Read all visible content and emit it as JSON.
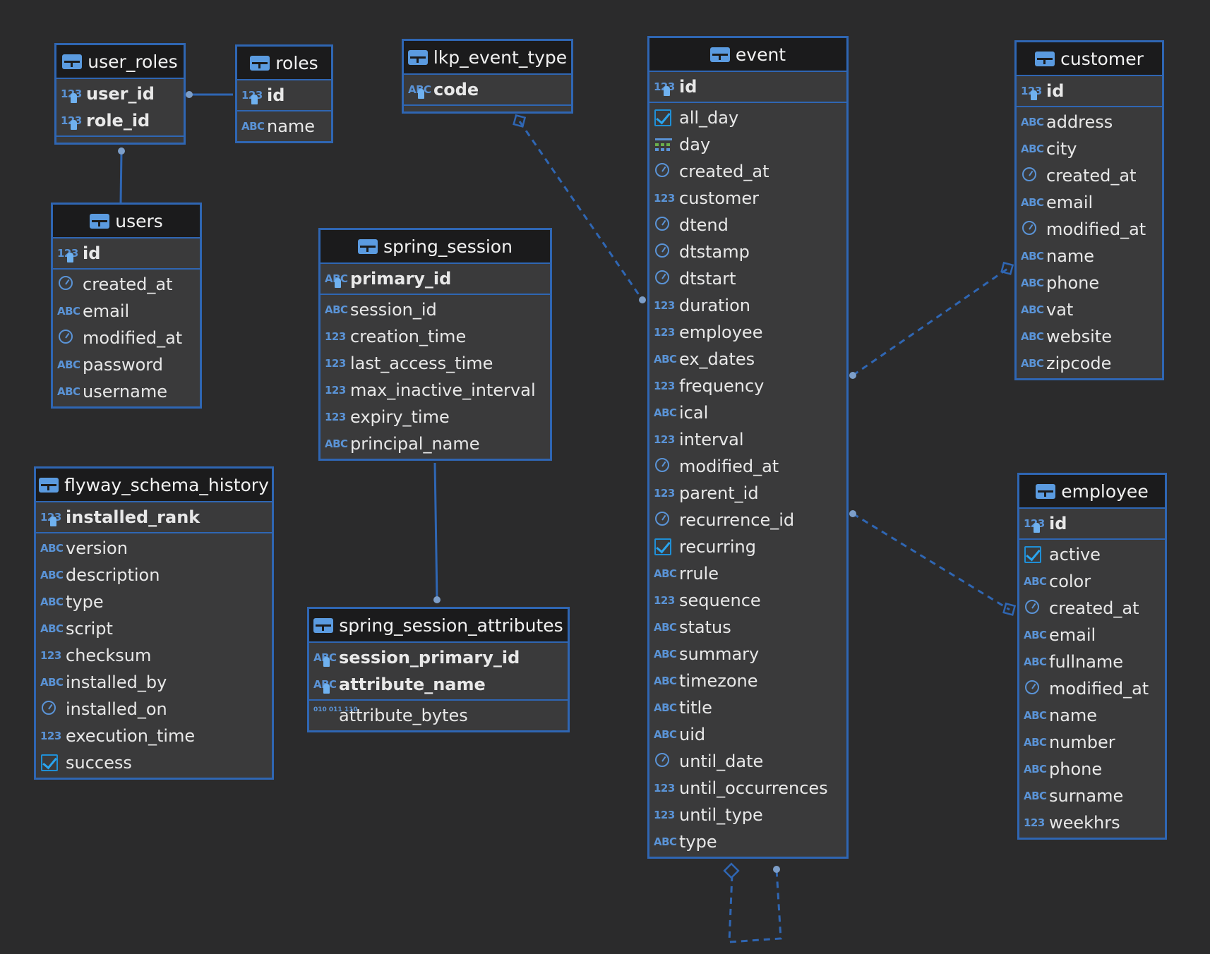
{
  "icons": {
    "table": "table-icon",
    "pk_num": "primary-key-number-icon",
    "pk_text": "primary-key-text-icon",
    "num": "number-icon",
    "text": "text-icon",
    "clock": "timestamp-icon",
    "check": "boolean-icon",
    "date": "date-icon",
    "bin": "binary-icon"
  },
  "colors": {
    "background": "#2b2b2c",
    "entity_border": "#2f66b3",
    "header_bg": "#1b1b1c",
    "body_bg": "#3a3a3b",
    "type_icon": "#5a93d6"
  },
  "tables": [
    {
      "id": "user_roles",
      "name": "user_roles",
      "keys": [
        {
          "name": "user_id",
          "type": "pk_num"
        },
        {
          "name": "role_id",
          "type": "pk_num"
        }
      ],
      "columns": []
    },
    {
      "id": "roles",
      "name": "roles",
      "keys": [
        {
          "name": "id",
          "type": "pk_num"
        }
      ],
      "columns": [
        {
          "name": "name",
          "type": "text"
        }
      ]
    },
    {
      "id": "lkp_event_type",
      "name": "lkp_event_type",
      "keys": [
        {
          "name": "code",
          "type": "pk_text"
        }
      ],
      "columns": []
    },
    {
      "id": "event",
      "name": "event",
      "keys": [
        {
          "name": "id",
          "type": "pk_num"
        }
      ],
      "columns": [
        {
          "name": "all_day",
          "type": "check"
        },
        {
          "name": "day",
          "type": "date"
        },
        {
          "name": "created_at",
          "type": "clock"
        },
        {
          "name": "customer",
          "type": "num"
        },
        {
          "name": "dtend",
          "type": "clock"
        },
        {
          "name": "dtstamp",
          "type": "clock"
        },
        {
          "name": "dtstart",
          "type": "clock"
        },
        {
          "name": "duration",
          "type": "num"
        },
        {
          "name": "employee",
          "type": "num"
        },
        {
          "name": "ex_dates",
          "type": "text"
        },
        {
          "name": "frequency",
          "type": "num"
        },
        {
          "name": "ical",
          "type": "text"
        },
        {
          "name": "interval",
          "type": "num"
        },
        {
          "name": "modified_at",
          "type": "clock"
        },
        {
          "name": "parent_id",
          "type": "num"
        },
        {
          "name": "recurrence_id",
          "type": "clock"
        },
        {
          "name": "recurring",
          "type": "check"
        },
        {
          "name": "rrule",
          "type": "text"
        },
        {
          "name": "sequence",
          "type": "num"
        },
        {
          "name": "status",
          "type": "text"
        },
        {
          "name": "summary",
          "type": "text"
        },
        {
          "name": "timezone",
          "type": "text"
        },
        {
          "name": "title",
          "type": "text"
        },
        {
          "name": "uid",
          "type": "text"
        },
        {
          "name": "until_date",
          "type": "clock"
        },
        {
          "name": "until_occurrences",
          "type": "num"
        },
        {
          "name": "until_type",
          "type": "num"
        },
        {
          "name": "type",
          "type": "text"
        }
      ]
    },
    {
      "id": "customer",
      "name": "customer",
      "keys": [
        {
          "name": "id",
          "type": "pk_num"
        }
      ],
      "columns": [
        {
          "name": "address",
          "type": "text"
        },
        {
          "name": "city",
          "type": "text"
        },
        {
          "name": "created_at",
          "type": "clock"
        },
        {
          "name": "email",
          "type": "text"
        },
        {
          "name": "modified_at",
          "type": "clock"
        },
        {
          "name": "name",
          "type": "text"
        },
        {
          "name": "phone",
          "type": "text"
        },
        {
          "name": "vat",
          "type": "text"
        },
        {
          "name": "website",
          "type": "text"
        },
        {
          "name": "zipcode",
          "type": "text"
        }
      ]
    },
    {
      "id": "users",
      "name": "users",
      "keys": [
        {
          "name": "id",
          "type": "pk_num"
        }
      ],
      "columns": [
        {
          "name": "created_at",
          "type": "clock"
        },
        {
          "name": "email",
          "type": "text"
        },
        {
          "name": "modified_at",
          "type": "clock"
        },
        {
          "name": "password",
          "type": "text"
        },
        {
          "name": "username",
          "type": "text"
        }
      ]
    },
    {
      "id": "spring_session",
      "name": "spring_session",
      "keys": [
        {
          "name": "primary_id",
          "type": "pk_text"
        }
      ],
      "columns": [
        {
          "name": "session_id",
          "type": "text"
        },
        {
          "name": "creation_time",
          "type": "num"
        },
        {
          "name": "last_access_time",
          "type": "num"
        },
        {
          "name": "max_inactive_interval",
          "type": "num"
        },
        {
          "name": "expiry_time",
          "type": "num"
        },
        {
          "name": "principal_name",
          "type": "text"
        }
      ]
    },
    {
      "id": "flyway_schema_history",
      "name": "flyway_schema_history",
      "keys": [
        {
          "name": "installed_rank",
          "type": "pk_num"
        }
      ],
      "columns": [
        {
          "name": "version",
          "type": "text"
        },
        {
          "name": "description",
          "type": "text"
        },
        {
          "name": "type",
          "type": "text"
        },
        {
          "name": "script",
          "type": "text"
        },
        {
          "name": "checksum",
          "type": "num"
        },
        {
          "name": "installed_by",
          "type": "text"
        },
        {
          "name": "installed_on",
          "type": "clock"
        },
        {
          "name": "execution_time",
          "type": "num"
        },
        {
          "name": "success",
          "type": "check"
        }
      ]
    },
    {
      "id": "spring_session_attributes",
      "name": "spring_session_attributes",
      "keys": [
        {
          "name": "session_primary_id",
          "type": "pk_text"
        },
        {
          "name": "attribute_name",
          "type": "pk_text"
        }
      ],
      "columns": [
        {
          "name": "attribute_bytes",
          "type": "bin"
        }
      ]
    },
    {
      "id": "employee",
      "name": "employee",
      "keys": [
        {
          "name": "id",
          "type": "pk_num"
        }
      ],
      "columns": [
        {
          "name": "active",
          "type": "check"
        },
        {
          "name": "color",
          "type": "text"
        },
        {
          "name": "created_at",
          "type": "clock"
        },
        {
          "name": "email",
          "type": "text"
        },
        {
          "name": "fullname",
          "type": "text"
        },
        {
          "name": "modified_at",
          "type": "clock"
        },
        {
          "name": "name",
          "type": "text"
        },
        {
          "name": "number",
          "type": "text"
        },
        {
          "name": "phone",
          "type": "text"
        },
        {
          "name": "surname",
          "type": "text"
        },
        {
          "name": "weekhrs",
          "type": "num"
        }
      ]
    }
  ],
  "relationships": [
    {
      "id": "user_roles-roles",
      "from": "user_roles",
      "to": "roles",
      "style": "solid"
    },
    {
      "id": "user_roles-users",
      "from": "user_roles",
      "to": "users",
      "style": "solid"
    },
    {
      "id": "spring_session-attributes",
      "from": "spring_session",
      "to": "spring_session_attributes",
      "style": "solid"
    },
    {
      "id": "event-lkp_event_type",
      "from": "event",
      "to": "lkp_event_type",
      "style": "dashed"
    },
    {
      "id": "event-customer",
      "from": "event",
      "to": "customer",
      "style": "dashed"
    },
    {
      "id": "event-employee",
      "from": "event",
      "to": "employee",
      "style": "dashed"
    },
    {
      "id": "event-self",
      "from": "event",
      "to": "event",
      "style": "dashed"
    }
  ]
}
